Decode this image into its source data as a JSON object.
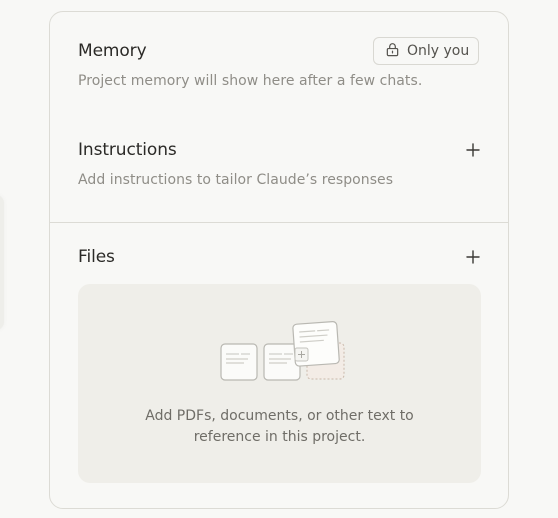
{
  "memory": {
    "title": "Memory",
    "subtitle": "Project memory will show here after a few chats.",
    "visibility_label": "Only you",
    "visibility_icon": "lock-icon"
  },
  "instructions": {
    "title": "Instructions",
    "subtitle": "Add instructions to tailor Claude’s responses",
    "add_icon": "plus-icon"
  },
  "files": {
    "title": "Files",
    "add_icon": "plus-icon",
    "empty_line1": "Add PDFs, documents, or other text to",
    "empty_line2": "reference in this project."
  },
  "colors": {
    "background": "#f8f8f6",
    "border": "#dcdbd5",
    "dropzone": "#efeee9",
    "title_text": "#2b2a27",
    "muted_text": "#8f8d87"
  }
}
